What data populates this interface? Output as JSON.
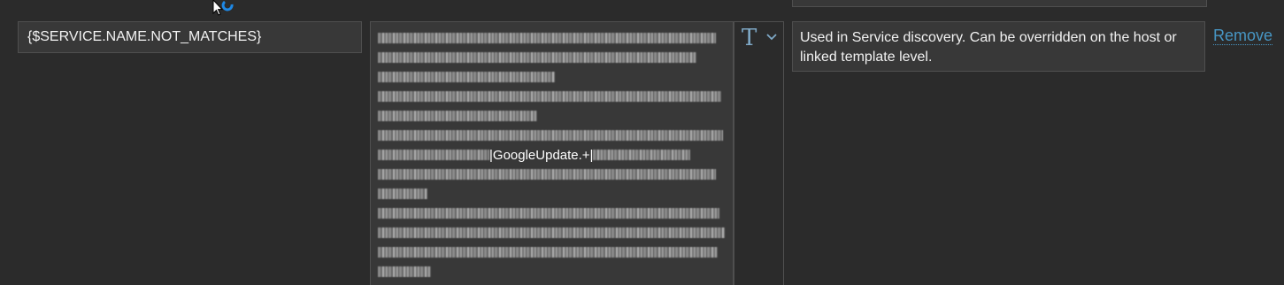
{
  "row": {
    "macro": "{$SERVICE.NAME.NOT_MATCHES}",
    "value": {
      "visible_fragment": "|GoogleUpdate.+|",
      "redacted": true
    },
    "type_selector": {
      "glyph": "T",
      "icon": "text-type-icon",
      "dropdown_icon": "chevron-down-icon"
    },
    "description": "Used in Service discovery. Can be overridden on the host or linked template level.",
    "remove_label": "Remove"
  },
  "colors": {
    "background": "#2b2b2b",
    "field_background": "#383838",
    "field_border": "#4f4f4f",
    "link": "#4796c4",
    "type_icon": "#7fa9c7"
  }
}
